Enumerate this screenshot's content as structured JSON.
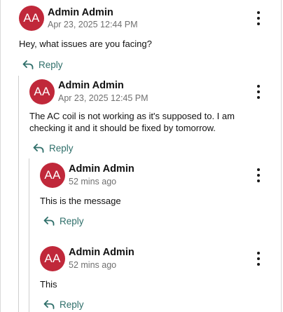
{
  "comments": [
    {
      "initials": "AA",
      "author": "Admin Admin",
      "timestamp": "Apr 23, 2025 12:44 PM",
      "body": "Hey, what issues are you facing?",
      "reply_label": "Reply",
      "more_icon": "more-vertical-icon",
      "reply_icon": "reply-arrow-icon"
    },
    {
      "initials": "AA",
      "author": "Admin Admin",
      "timestamp": "Apr 23, 2025 12:45 PM",
      "body": "The AC coil is not working as it's supposed to. I am checking it and it should be fixed by tomorrow.",
      "reply_label": "Reply",
      "more_icon": "more-vertical-icon",
      "reply_icon": "reply-arrow-icon"
    },
    {
      "initials": "AA",
      "author": "Admin Admin",
      "timestamp": "52 mins ago",
      "body": "This is the message",
      "reply_label": "Reply",
      "more_icon": "more-vertical-icon",
      "reply_icon": "reply-arrow-icon"
    },
    {
      "initials": "AA",
      "author": "Admin Admin",
      "timestamp": "52 mins ago",
      "body": "This",
      "reply_label": "Reply",
      "more_icon": "more-vertical-icon",
      "reply_icon": "reply-arrow-icon"
    }
  ],
  "colors": {
    "avatar_bg": "#c0283a",
    "reply_accent": "#2f6f6a",
    "thread_line": "#cfcfcf"
  }
}
